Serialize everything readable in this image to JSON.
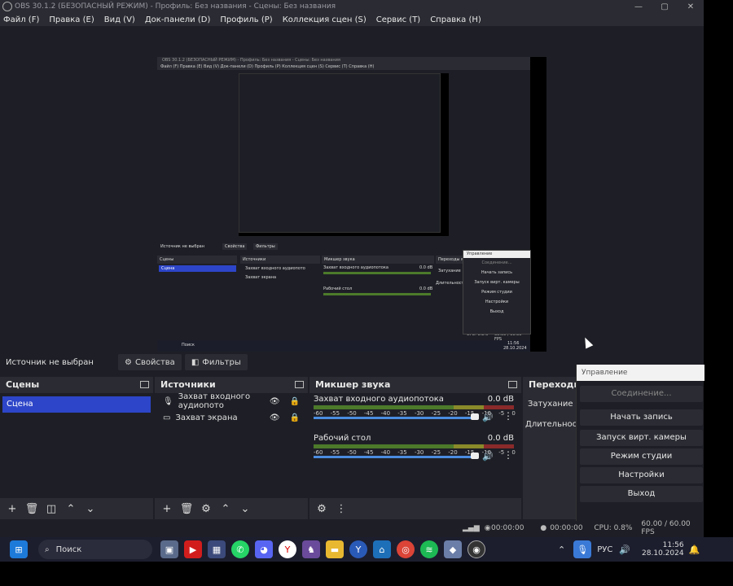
{
  "window": {
    "title": "OBS 30.1.2 (БЕЗОПАСНЫЙ РЕЖИМ) - Профиль: Без названия - Сцены: Без названия",
    "controls": [
      "—",
      "▢",
      "✕"
    ]
  },
  "menu": [
    "Файл (F)",
    "Правка (E)",
    "Вид (V)",
    "Док-панели (D)",
    "Профиль (P)",
    "Коллекция сцен (S)",
    "Сервис (T)",
    "Справка (H)"
  ],
  "nested": {
    "title": "OBS 30.1.2 (БЕЗОПАСНЫЙ РЕЖИМ) - Профиль: Без названия - Сцены: Без названия",
    "menu": "Файл (F)   Правка (E)   Вид (V)   Док-панели (D)   Профиль (P)   Коллекция сцен (S)   Сервис (T)   Справка (H)",
    "source_label": "Источник не выбран",
    "props": "Свойства",
    "filters": "Фильтры",
    "scenes": "Сцены",
    "scene": "Сцена",
    "sources": "Источники",
    "mixer": "Микшер звука",
    "transitions": "Переходы м",
    "src1": "Захват входного аудиопото",
    "src2": "Захват экрана",
    "ch1": "Захват входного аудиопотока",
    "ch2": "Рабочий стол",
    "db": "0.0 dB",
    "fade": "Затухание",
    "dur": "Длительность",
    "search": "Поиск",
    "time": "11:56",
    "date": "28.10.2024",
    "menu_header": "Управление",
    "menu_items": [
      "Соединение...",
      "Начать запись",
      "Запуск вирт. камеры",
      "Режим студии",
      "Настройки",
      "Выход"
    ],
    "cpu": "CPU: 0.8%",
    "fps": "60.00 / 60.00 FPS"
  },
  "source_bar": {
    "label": "Источник не выбран",
    "properties": "Свойства",
    "filters": "Фильтры"
  },
  "docks": {
    "scenes": {
      "title": "Сцены",
      "items": [
        "Сцена"
      ]
    },
    "sources": {
      "title": "Источники",
      "items": [
        "Захват входного аудиопото",
        "Захват экрана"
      ]
    },
    "mixer": {
      "title": "Микшер звука",
      "channels": [
        {
          "name": "Захват входного аудиопотока",
          "db": "0.0 dB"
        },
        {
          "name": "Рабочий стол",
          "db": "0.0 dB"
        }
      ],
      "ticks": [
        "-60",
        "-55",
        "-50",
        "-45",
        "-40",
        "-35",
        "-30",
        "-25",
        "-20",
        "-15",
        "-10",
        "-5",
        "0"
      ]
    },
    "transitions": {
      "title": "Переходы м",
      "fade": "Затухание",
      "duration": "Длительность"
    }
  },
  "control_menu": {
    "header": "Управление",
    "items": [
      "Соединение...",
      "Начать запись",
      "Запуск вирт. камеры",
      "Режим студии",
      "Настройки",
      "Выход"
    ]
  },
  "status": {
    "stream_time": "00:00:00",
    "rec_time": "00:00:00",
    "cpu": "CPU: 0.8%",
    "fps": "60.00 / 60.00 FPS"
  },
  "taskbar": {
    "search": "Поиск",
    "lang": "РУС",
    "time": "11:56",
    "date": "28.10.2024"
  },
  "colors": {
    "accent": "#2d45c8",
    "bg": "#1e1f26",
    "panel": "#2b2c33"
  }
}
